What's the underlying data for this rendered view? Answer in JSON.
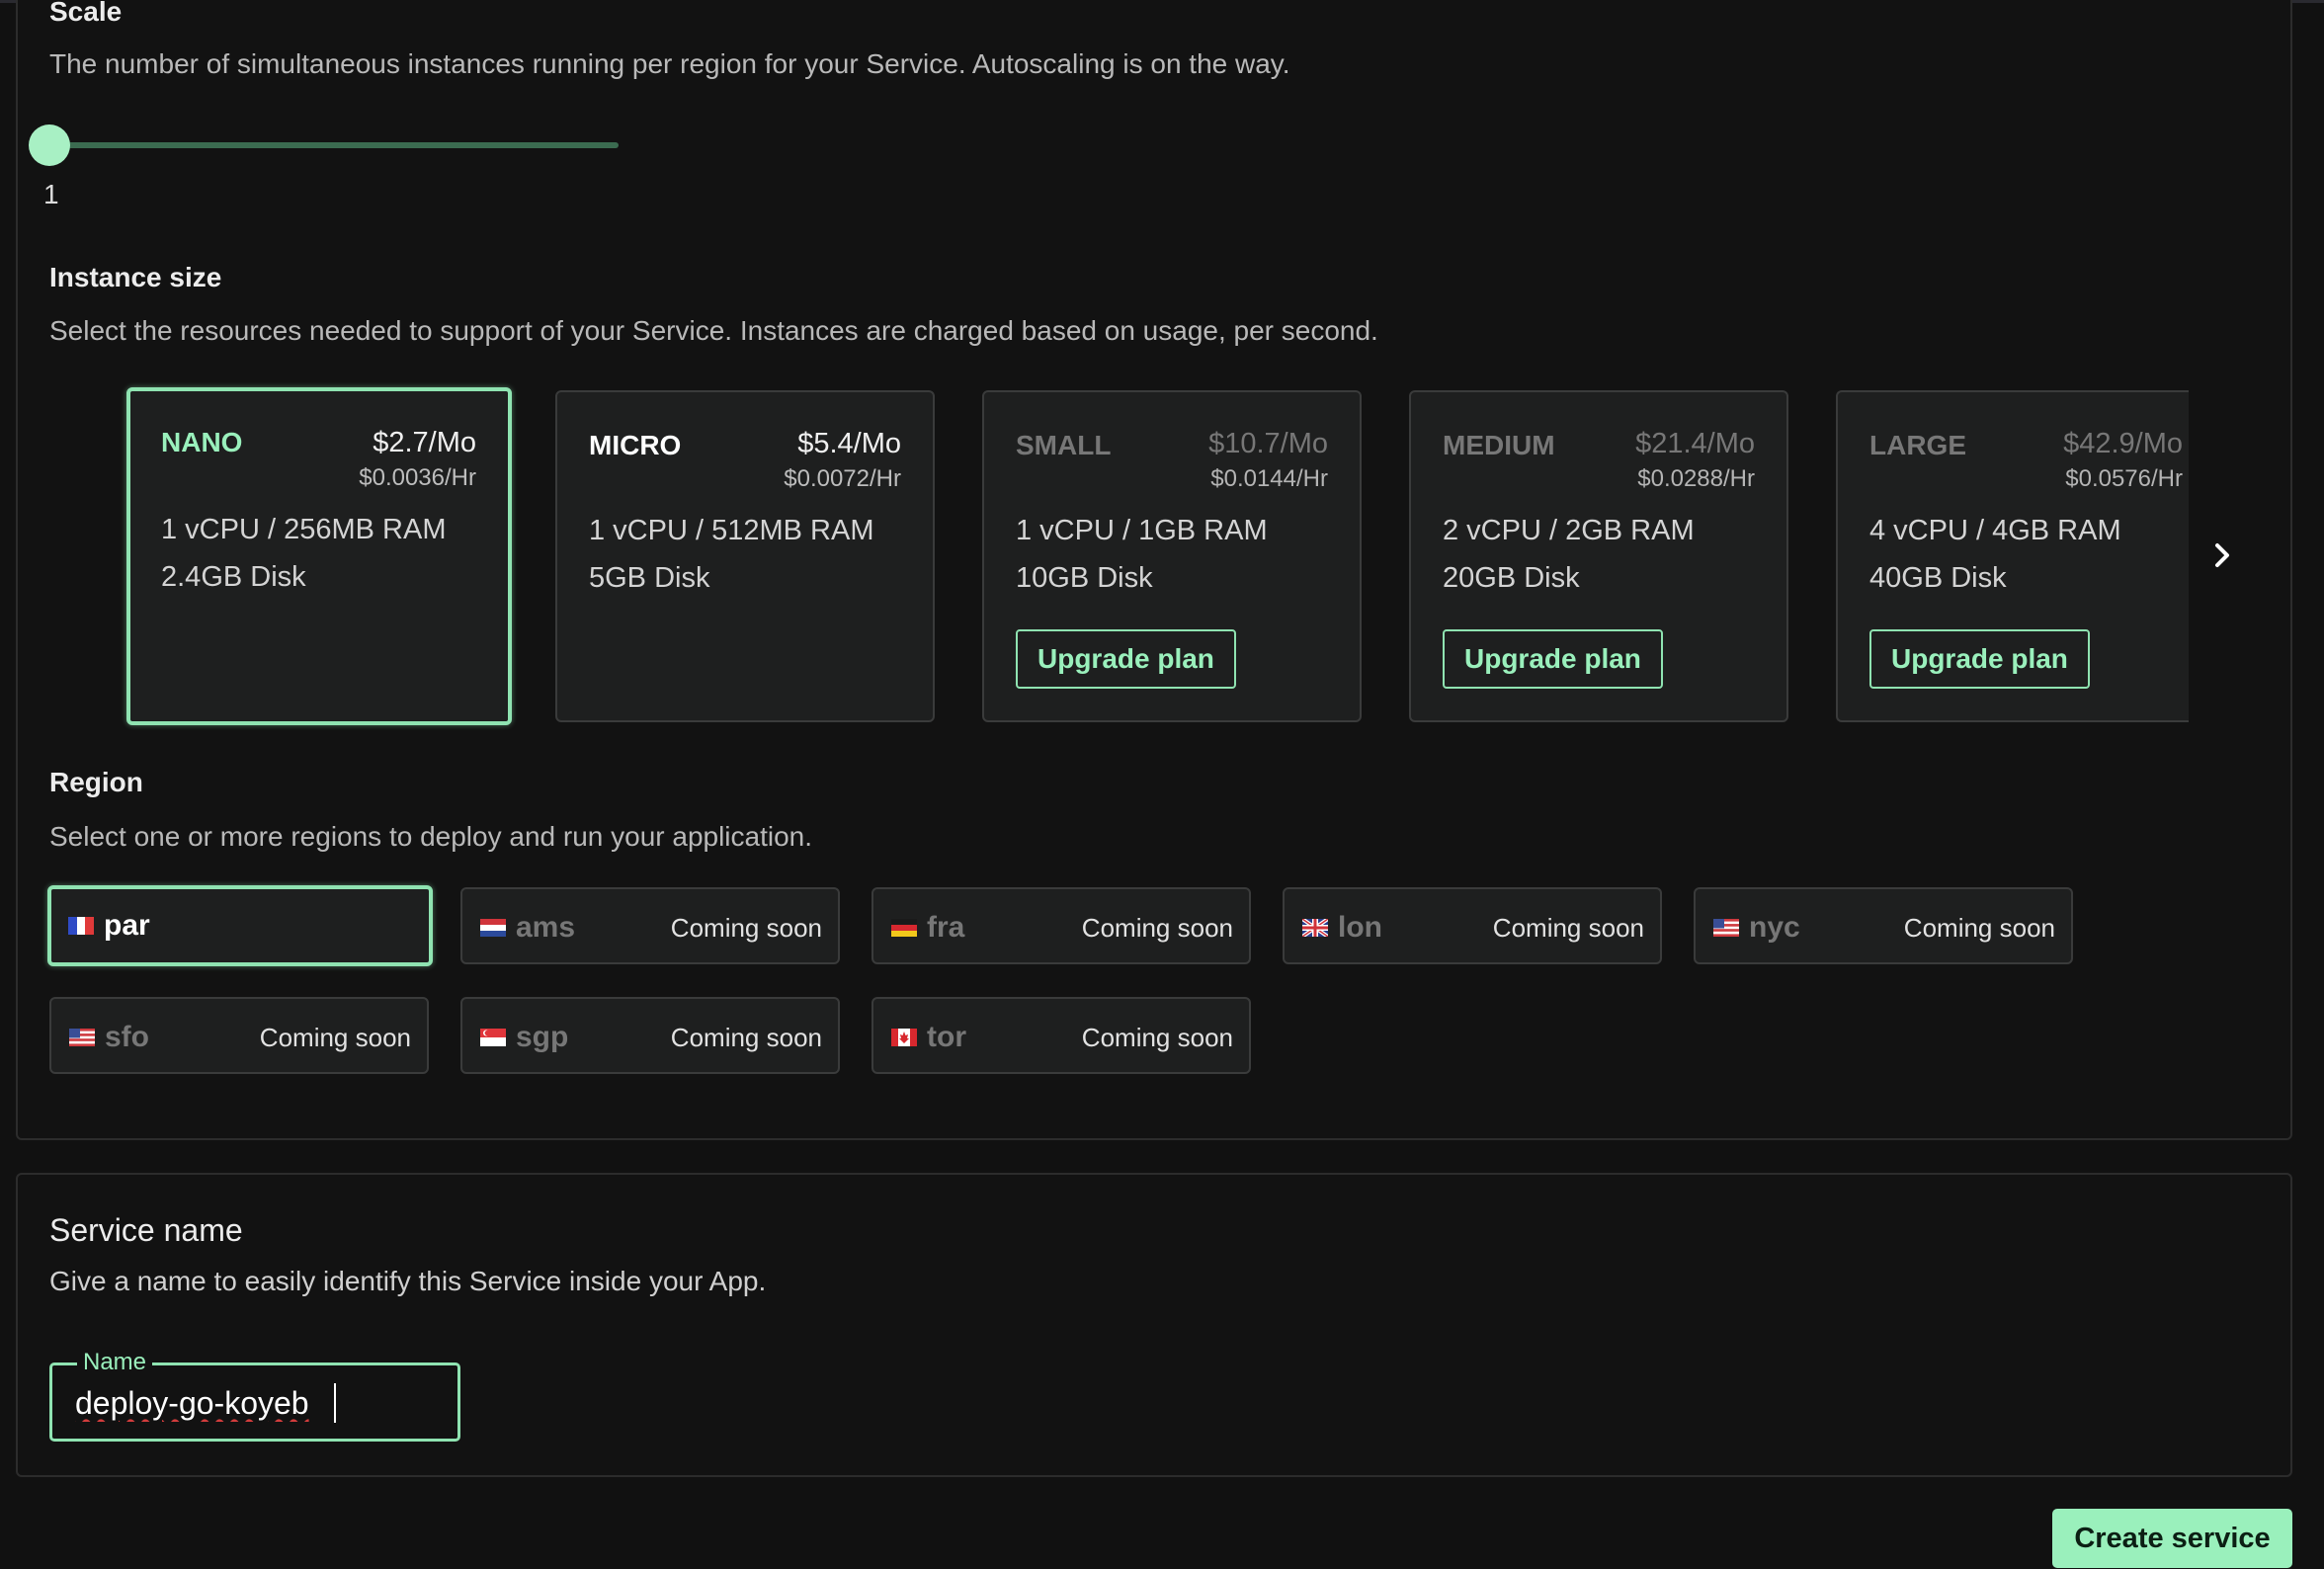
{
  "scale": {
    "title": "Scale",
    "description": "The number of simultaneous instances running per region for your Service. Autoscaling is on the way.",
    "value": "1",
    "slider_fraction": 0.0
  },
  "instance_size": {
    "title": "Instance size",
    "description": "Select the resources needed to support of your Service. Instances are charged based on usage, per second.",
    "cards": [
      {
        "name": "NANO",
        "price": "$2.7/Mo",
        "hourly": "$0.0036/Hr",
        "cpu_ram": "1 vCPU / 256MB RAM",
        "disk": "2.4GB Disk",
        "selected": true,
        "upgrade": ""
      },
      {
        "name": "MICRO",
        "price": "$5.4/Mo",
        "hourly": "$0.0072/Hr",
        "cpu_ram": "1 vCPU / 512MB RAM",
        "disk": "5GB Disk",
        "selected": false,
        "upgrade": ""
      },
      {
        "name": "SMALL",
        "price": "$10.7/Mo",
        "hourly": "$0.0144/Hr",
        "cpu_ram": "1 vCPU / 1GB RAM",
        "disk": "10GB Disk",
        "selected": false,
        "upgrade": "Upgrade plan"
      },
      {
        "name": "MEDIUM",
        "price": "$21.4/Mo",
        "hourly": "$0.0288/Hr",
        "cpu_ram": "2 vCPU / 2GB RAM",
        "disk": "20GB Disk",
        "selected": false,
        "upgrade": "Upgrade plan"
      },
      {
        "name": "LARGE",
        "price": "$42.9/Mo",
        "hourly": "$0.0576/Hr",
        "cpu_ram": "4 vCPU / 4GB RAM",
        "disk": "40GB Disk",
        "selected": false,
        "upgrade": "Upgrade plan"
      }
    ],
    "next_icon": "chevron-right-icon"
  },
  "region": {
    "title": "Region",
    "description": "Select one or more regions to deploy and run your application.",
    "items": [
      {
        "code": "par",
        "flag": "france-flag-icon",
        "status": "",
        "selected": true
      },
      {
        "code": "ams",
        "flag": "netherlands-flag-icon",
        "status": "Coming soon",
        "selected": false
      },
      {
        "code": "fra",
        "flag": "germany-flag-icon",
        "status": "Coming soon",
        "selected": false
      },
      {
        "code": "lon",
        "flag": "uk-flag-icon",
        "status": "Coming soon",
        "selected": false
      },
      {
        "code": "nyc",
        "flag": "usa-flag-icon",
        "status": "Coming soon",
        "selected": false
      },
      {
        "code": "sfo",
        "flag": "usa-flag-icon",
        "status": "Coming soon",
        "selected": false
      },
      {
        "code": "sgp",
        "flag": "singapore-flag-icon",
        "status": "Coming soon",
        "selected": false
      },
      {
        "code": "tor",
        "flag": "canada-flag-icon",
        "status": "Coming soon",
        "selected": false
      }
    ]
  },
  "service_name": {
    "title": "Service name",
    "description": "Give a name to easily identify this Service inside your App.",
    "field_label": "Name",
    "value": "deploy-go-koyeb"
  },
  "actions": {
    "create_label": "Create service"
  },
  "colors": {
    "accent": "#9af0bc",
    "background": "#111111",
    "card": "#1e1f1f"
  }
}
